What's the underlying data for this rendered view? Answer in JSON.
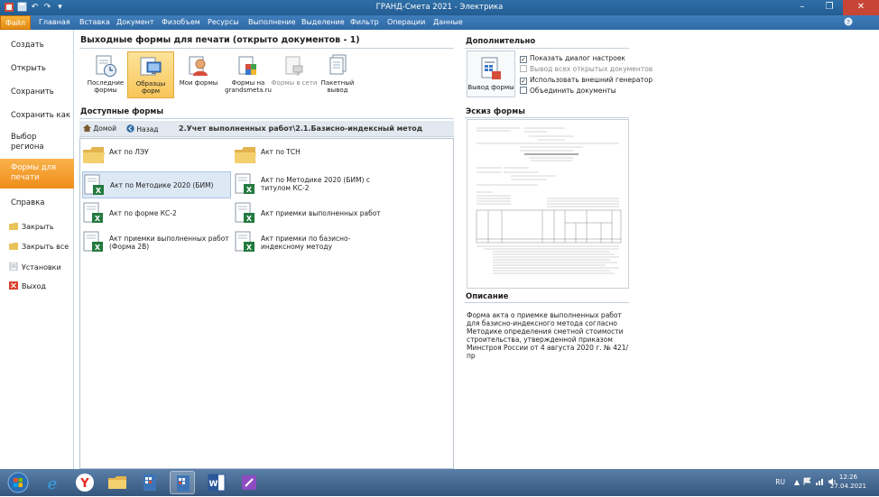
{
  "window": {
    "title": "ГРАНД-Смета 2021 - Электрика"
  },
  "menu": {
    "file": "Файл",
    "tabs": [
      "Главная",
      "Вставка",
      "Документ",
      "Физобъем",
      "Ресурсы",
      "Выполнение",
      "Выделение",
      "Фильтр",
      "Операции",
      "Данные"
    ]
  },
  "leftnav": {
    "items": [
      "Создать",
      "Открыть",
      "Сохранить",
      "Сохранить как",
      "Выбор региона",
      "Формы для печати",
      "Справка"
    ],
    "active": "Формы для печати",
    "sub": [
      "Закрыть",
      "Закрыть все",
      "Установки",
      "Выход"
    ]
  },
  "main": {
    "title": "Выходные формы для печати (открыто документов - 1)",
    "buttons": [
      {
        "label": "Последние формы",
        "state": "normal",
        "icon": "clock-doc-icon"
      },
      {
        "label": "Образцы форм",
        "state": "selected",
        "icon": "monitor-doc-icon"
      },
      {
        "label": "Мои формы",
        "state": "normal",
        "icon": "user-icon"
      },
      {
        "label": "Формы на grandsmeta.ru",
        "state": "normal",
        "icon": "web-doc-icon"
      },
      {
        "label": "Формы в сети",
        "state": "disabled",
        "icon": "network-doc-icon"
      },
      {
        "label": "Пакетный вывод",
        "state": "normal",
        "icon": "batch-doc-icon"
      }
    ],
    "available_title": "Доступные формы",
    "pathbar": {
      "home": "Домой",
      "back": "Назад",
      "path": "2.Учет выполненных работ\\2.1.Базисно-индексный метод"
    },
    "files": [
      {
        "name": "Акт по ЛЭУ",
        "type": "folder"
      },
      {
        "name": "Акт по ТСН",
        "type": "folder"
      },
      {
        "name": "Акт по Методике 2020 (БИМ)",
        "type": "excel",
        "selected": true
      },
      {
        "name": "Акт по Методике 2020 (БИМ) с титулом КС-2",
        "type": "excel"
      },
      {
        "name": "Акт по форме КС-2",
        "type": "excel"
      },
      {
        "name": "Акт приемки выполненных работ",
        "type": "excel"
      },
      {
        "name": "Акт приемки выполненных работ (Форма 2В)",
        "type": "excel"
      },
      {
        "name": "Акт приемки по базисно-индексному методу",
        "type": "excel"
      }
    ]
  },
  "right": {
    "additional_title": "Дополнительно",
    "export_label": "Вывод формы",
    "options": [
      {
        "label": "Показать диалог настроек",
        "checked": true,
        "disabled": false
      },
      {
        "label": "Вывод всех открытых документов",
        "checked": false,
        "disabled": true
      },
      {
        "label": "Использовать внешний генератор",
        "checked": true,
        "disabled": false
      },
      {
        "label": "Объединить документы",
        "checked": false,
        "disabled": false
      }
    ],
    "sketch_title": "Эскиз формы",
    "description_title": "Описание",
    "description": "Форма акта о приемке выполненных работ для базисно-индексного метода согласно Методике определения сметной стоимости строительства, утвержденной приказом Минстроя России от 4 августа 2020 г. № 421/пр"
  },
  "taskbar": {
    "lang": "RU",
    "time": "12:26",
    "date": "27.04.2021"
  }
}
